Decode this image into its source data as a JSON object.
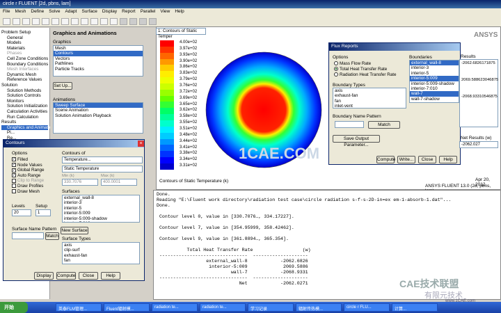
{
  "window": {
    "title": "circle r FLUENT  [2d, pbns, lam]"
  },
  "menu": [
    "File",
    "Mesh",
    "Define",
    "Solve",
    "Adapt",
    "Surface",
    "Display",
    "Report",
    "Parallel",
    "View",
    "Help"
  ],
  "tree": [
    {
      "t": "Problem Setup",
      "c": "sec"
    },
    {
      "t": "General",
      "c": "sub"
    },
    {
      "t": "Models",
      "c": "sub"
    },
    {
      "t": "Materials",
      "c": "sub"
    },
    {
      "t": "Phases",
      "c": "sub dis"
    },
    {
      "t": "Cell Zone Conditions",
      "c": "sub"
    },
    {
      "t": "Boundary Conditions",
      "c": "sub"
    },
    {
      "t": "Mesh Interfaces",
      "c": "sub dis"
    },
    {
      "t": "Dynamic Mesh",
      "c": "sub"
    },
    {
      "t": "Reference Values",
      "c": "sub"
    },
    {
      "t": "Solution",
      "c": "sec"
    },
    {
      "t": "Solution Methods",
      "c": "sub"
    },
    {
      "t": "Solution Controls",
      "c": "sub"
    },
    {
      "t": "Monitors",
      "c": "sub"
    },
    {
      "t": "Solution Initialization",
      "c": "sub"
    },
    {
      "t": "Calculation Activities",
      "c": "sub"
    },
    {
      "t": "Run Calculation",
      "c": "sub"
    },
    {
      "t": "Results",
      "c": "sec"
    },
    {
      "t": "Graphics and Animations",
      "c": "sub sel"
    },
    {
      "t": "Pl...",
      "c": "sub"
    },
    {
      "t": "Re...",
      "c": "sub"
    }
  ],
  "graphics_panel": {
    "title": "Graphics and Animations",
    "graphics_label": "Graphics",
    "graphics": [
      "Mesh",
      "Contours",
      "Vectors",
      "Pathlines",
      "Particle Tracks"
    ],
    "selected": 1,
    "setup": "Set Up...",
    "animations_label": "Animations",
    "animations": [
      "Sweep Surface",
      "Scene Animation",
      "Solution Animation Playback"
    ]
  },
  "view": {
    "combo": "1: Contours of Static Temper",
    "caption": "Contours of Static Temperature (k)",
    "date": "Apr 20, 2012",
    "version": "ANSYS FLUENT 13.0 (2d, pbns, lam)",
    "brand": "ANSYS",
    "legend": [
      "4.00e+02",
      "3.97e+02",
      "3.93e+02",
      "3.90e+02",
      "3.86e+02",
      "3.83e+02",
      "3.79e+02",
      "3.76e+02",
      "3.72e+02",
      "3.69e+02",
      "3.65e+02",
      "3.62e+02",
      "3.58e+02",
      "3.55e+02",
      "3.51e+02",
      "3.48e+02",
      "3.44e+02",
      "3.41e+02",
      "3.38e+02",
      "3.34e+02",
      "3.31e+02"
    ],
    "legend_colors": [
      "#ff0000",
      "#ff3300",
      "#ff6600",
      "#ff9900",
      "#ffcc00",
      "#ffee00",
      "#eeff00",
      "#ccff00",
      "#99ff00",
      "#66ff00",
      "#33ff33",
      "#00ff66",
      "#00ff99",
      "#00ffcc",
      "#00eeff",
      "#00ccff",
      "#0099ff",
      "#0066ff",
      "#0033ff",
      "#0000ff",
      "#0000cc"
    ],
    "watermark": "1CAE.COM"
  },
  "contours": {
    "title": "Contours",
    "options_label": "Options",
    "options": [
      {
        "t": "Filled",
        "on": true
      },
      {
        "t": "Node Values",
        "on": true
      },
      {
        "t": "Global Range",
        "on": true
      },
      {
        "t": "Auto Range",
        "on": true
      },
      {
        "t": "Clip to Range",
        "on": false,
        "dis": true
      },
      {
        "t": "Draw Profiles",
        "on": false
      },
      {
        "t": "Draw Mesh",
        "on": false
      }
    ],
    "contours_of": "Contours of",
    "sel1": "Temperature...",
    "sel2": "Static Temperature",
    "min_label": "Min (k)",
    "max_label": "Max (k)",
    "min": "330.7076",
    "max": "400.0001",
    "surfaces_label": "Surfaces",
    "surfaces": [
      "external_wall-8",
      "interior-3",
      "interior-5",
      "interior-5:009",
      "interior-5:009-shadow",
      "interior-7:010"
    ],
    "levels_label": "Levels",
    "levels": "20",
    "setup_label": "Setup",
    "setup": "1",
    "name_pattern": "Surface Name Pattern",
    "match": "Match",
    "new_surface": "New Surface",
    "surface_types": "Surface Types",
    "types": [
      "axis",
      "clip-surf",
      "exhaust-fan",
      "fan"
    ],
    "buttons": [
      "Display",
      "Compute",
      "Close",
      "Help"
    ]
  },
  "flux": {
    "title": "Flux Reports",
    "options_label": "Options",
    "options": [
      {
        "t": "Mass Flow Rate",
        "on": false
      },
      {
        "t": "Total Heat Transfer Rate",
        "on": true
      },
      {
        "t": "Radiation Heat Transfer Rate",
        "on": false
      }
    ],
    "boundaries_label": "Boundaries",
    "boundaries": [
      {
        "t": "external_wall-8",
        "s": true
      },
      {
        "t": "interior-3",
        "s": false
      },
      {
        "t": "interior-5",
        "s": false
      },
      {
        "t": "interior-5:009",
        "s": true
      },
      {
        "t": "interior-5:009-shadow",
        "s": false
      },
      {
        "t": "interior-7:010",
        "s": false
      },
      {
        "t": "wall-7",
        "s": true
      },
      {
        "t": "wall-7-shadow",
        "s": false
      }
    ],
    "types_label": "Boundary Types",
    "types": [
      "axis",
      "exhaust-fan",
      "fan",
      "inlet-vent"
    ],
    "pattern_label": "Boundary Name Pattern",
    "match": "Match",
    "save": "Save Output Parameter...",
    "results_label": "Results",
    "results": [
      "-2062.6826171875",
      "2069.588623046875",
      "-2068.93310546875"
    ],
    "net_label": "Net Results (w)",
    "net": "-2062.027",
    "buttons": [
      "Compute",
      "Write...",
      "Close",
      "Help"
    ]
  },
  "console": {
    "lines": [
      "Done.",
      "Reading \"E:\\Fluent work directory\\radiation test case\\circle radiation s-f-s-2D-in=ex em-1-absorb-1.dat\"...",
      "Done.",
      "",
      " Contour level 0, value in [330.7076…, 334.17227].",
      "",
      " Contour level 7, value in [354.95999, 358.42462].",
      "",
      " Contour level 9, value in [361.8894…, 365.354].",
      "",
      "           Total Heat Transfer Rate                  (w)",
      " --------------------------------  --------------------",
      "                  external_wall-8            -2062.6826",
      "                   interior-5:009             2069.5886",
      "                           wall-7            -2068.9331",
      " --------------------------------  --------------------",
      "                              Net            -2062.0271"
    ],
    "watermark": "CAE技术联盟",
    "watermark2": "有限元技术",
    "site": "www.1CAE.com"
  },
  "taskbar": {
    "start": "开始",
    "tasks": [
      "英泰FLM管理...",
      "Fluent辐射模...",
      "radiation te...",
      "radiation te...",
      "学习记录",
      "辐射传热模...",
      "circle r FLU...",
      "计算..."
    ]
  }
}
